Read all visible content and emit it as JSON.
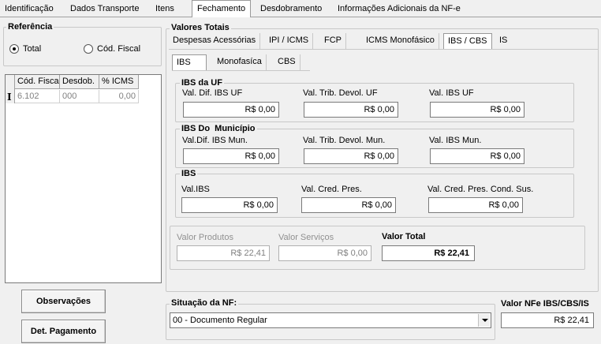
{
  "main_tabs": [
    {
      "label": "Identificação",
      "active": false
    },
    {
      "label": "Dados Transporte",
      "active": false
    },
    {
      "label": "Itens",
      "active": false
    },
    {
      "label": "Fechamento",
      "active": true
    },
    {
      "label": "Desdobramento",
      "active": false
    },
    {
      "label": "Informações Adicionais da NF-e",
      "active": false
    }
  ],
  "referencia": {
    "title": "Referência",
    "options": [
      {
        "label": "Total",
        "selected": true
      },
      {
        "label": "Cód. Fiscal",
        "selected": false
      }
    ]
  },
  "grid": {
    "columns": [
      "Cód. Fiscal",
      "Desdob.",
      "% ICMS"
    ],
    "rows": [
      {
        "cod_fiscal": "6.102",
        "desdob": "000",
        "icms": "0,00"
      }
    ]
  },
  "buttons": {
    "observacoes": "Observações",
    "det_pagamento": "Det. Pagamento"
  },
  "valores_totais": {
    "title": "Valores Totais",
    "tabs": [
      {
        "label": "Despesas Acessórias",
        "active": false
      },
      {
        "label": "IPI / ICMS",
        "active": false
      },
      {
        "label": "FCP",
        "active": false
      },
      {
        "label": "ICMS Monofásico",
        "active": false
      },
      {
        "label": "IBS / CBS",
        "active": true
      },
      {
        "label": "IS",
        "active": false
      }
    ],
    "subtabs": [
      {
        "label": "IBS",
        "active": true
      },
      {
        "label": "Monofasíca",
        "active": false
      },
      {
        "label": "CBS",
        "active": false
      }
    ]
  },
  "ibs_uf": {
    "title": "IBS da UF",
    "fields": [
      {
        "label": "Val. Dif. IBS UF",
        "value": "R$ 0,00"
      },
      {
        "label": "Val. Trib. Devol. UF",
        "value": "R$ 0,00"
      },
      {
        "label": "Val. IBS UF",
        "value": "R$ 0,00"
      }
    ]
  },
  "ibs_mun": {
    "title": "IBS Do  Município",
    "fields": [
      {
        "label": "Val.Dif. IBS Mun.",
        "value": "R$ 0,00"
      },
      {
        "label": "Val. Trib. Devol. Mun.",
        "value": "R$ 0,00"
      },
      {
        "label": "Val. IBS Mun.",
        "value": "R$ 0,00"
      }
    ]
  },
  "ibs": {
    "title": "IBS",
    "fields": [
      {
        "label": "Val.IBS",
        "value": "R$ 0,00"
      },
      {
        "label": "Val. Cred. Pres.",
        "value": "R$ 0,00"
      },
      {
        "label": "Val. Cred. Pres. Cond. Sus.",
        "value": "R$ 0,00"
      }
    ]
  },
  "totais": {
    "valor_produtos_label": "Valor Produtos",
    "valor_produtos": "R$ 22,41",
    "valor_servicos_label": "Valor Serviços",
    "valor_servicos": "R$ 0,00",
    "valor_total_label": "Valor Total",
    "valor_total": "R$ 22,41"
  },
  "situacao": {
    "label": "Situação da NF:",
    "value": "00 - Documento Regular",
    "valor_nfe_label": "Valor NFe IBS/CBS/IS",
    "valor_nfe": "R$ 22,41"
  }
}
